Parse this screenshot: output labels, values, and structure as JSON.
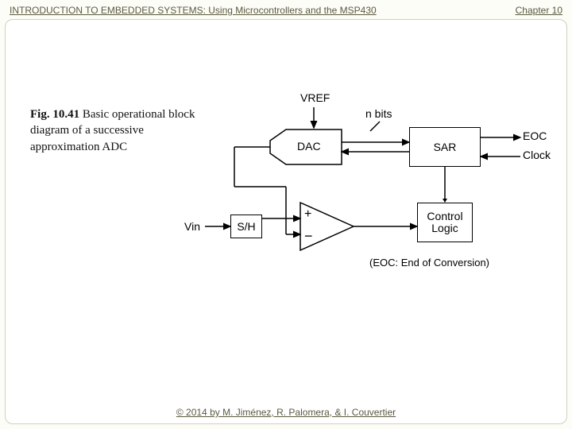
{
  "header": {
    "title": "INTRODUCTION TO EMBEDDED SYSTEMS: Using Microcontrollers and the MSP430",
    "chapter": "Chapter 10"
  },
  "footer": {
    "copyright": "© 2014 by M. Jiménez, R. Palomera, & I. Couvertier"
  },
  "caption": {
    "fig_label": "Fig. 10.41",
    "text": "Basic operational block diagram of a successive approximation ADC"
  },
  "diagram": {
    "labels": {
      "vref": "VREF",
      "nbits": "n bits",
      "eoc": "EOC",
      "clock": "Clock",
      "vin": "Vin",
      "plus": "+",
      "minus": "−"
    },
    "blocks": {
      "dac": "DAC",
      "sar": "SAR",
      "sh": "S/H",
      "control": "Control Logic"
    },
    "note": "(EOC: End of Conversion)"
  }
}
